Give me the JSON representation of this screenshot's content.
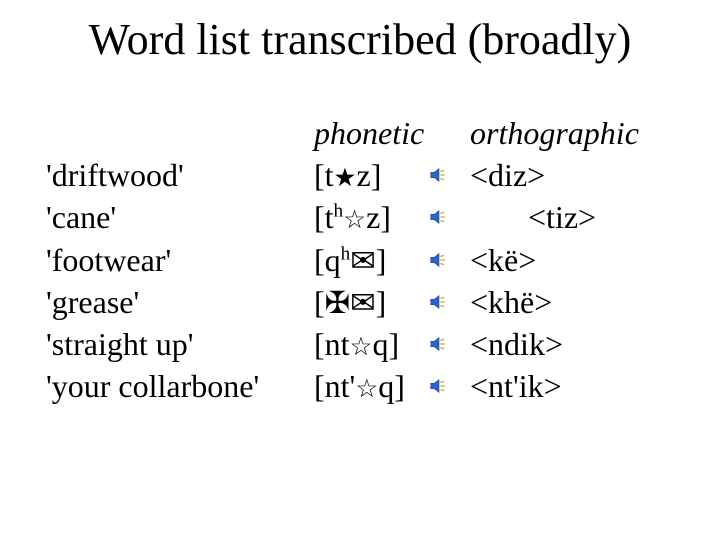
{
  "title": "Word list transcribed (broadly)",
  "headers": {
    "phonetic": "phonetic",
    "orthographic": "orthographic"
  },
  "glyphs": {
    "star_filled": "★",
    "star_outline": "☆",
    "maltese": "✠",
    "envelope": "✉"
  },
  "icon_name": "speaker-icon",
  "rows": [
    {
      "gloss": "'driftwood'",
      "phon_parts": [
        "[t",
        {
          "g": "star_filled"
        },
        "z]"
      ],
      "orth": "<diz>",
      "orth_indent": false
    },
    {
      "gloss": "'cane'",
      "phon_parts": [
        "[t",
        {
          "sup": "h"
        },
        {
          "g": "star_outline"
        },
        "z]"
      ],
      "orth": "<tiz>",
      "orth_indent": true
    },
    {
      "gloss": "'footwear'",
      "phon_parts": [
        "[q",
        {
          "sup": "h"
        },
        {
          "g": "envelope"
        },
        "]"
      ],
      "orth": "<kë>",
      "orth_indent": false
    },
    {
      "gloss": "'grease'",
      "phon_parts": [
        "[",
        {
          "g": "maltese"
        },
        {
          "g": "envelope"
        },
        "]"
      ],
      "orth": "<khë>",
      "orth_indent": false
    },
    {
      "gloss": "'straight up'",
      "phon_parts": [
        "[nt",
        {
          "g": "star_outline"
        },
        "q]"
      ],
      "orth": "<ndik>",
      "orth_indent": false
    },
    {
      "gloss": "'your collarbone'",
      "phon_parts": [
        "[nt'",
        {
          "g": "star_outline"
        },
        "q]"
      ],
      "orth": "<nt'ik>",
      "orth_indent": false
    }
  ]
}
